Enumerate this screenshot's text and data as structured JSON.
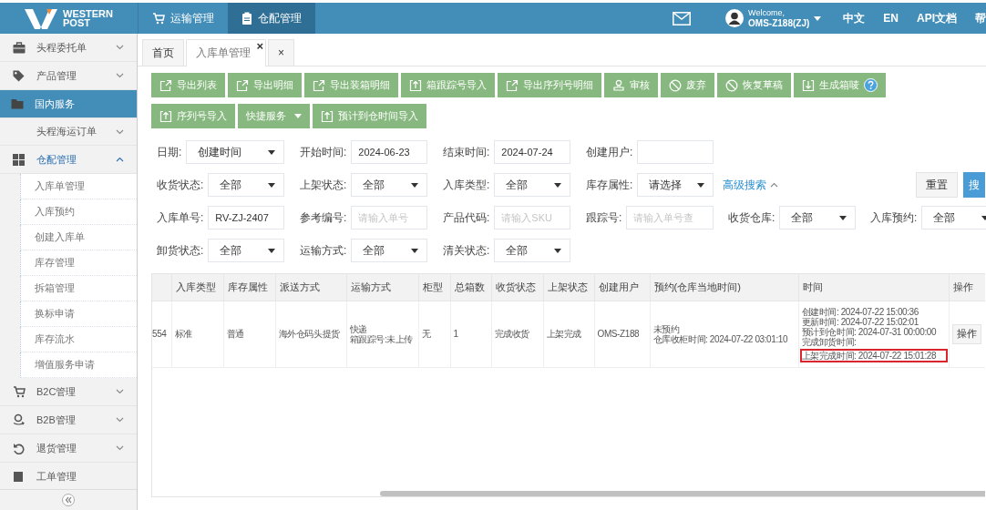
{
  "header": {
    "logo": [
      "WESTERN",
      "POST"
    ],
    "nav": [
      {
        "label": "运输管理",
        "selected": false
      },
      {
        "label": "仓配管理",
        "selected": true
      }
    ],
    "welcome": "Welcome,",
    "user": "OMS-Z188(ZJ)",
    "links": [
      "中文",
      "EN",
      "API文档",
      "帮"
    ]
  },
  "sidebar": {
    "items": [
      {
        "label": "头程委托单",
        "expanded": false,
        "selected": false
      },
      {
        "label": "产品管理",
        "expanded": false,
        "selected": false
      },
      {
        "label": "国内服务",
        "selected": true,
        "children": [
          {
            "label": "头程海运订单",
            "expanded": false,
            "selected": false
          }
        ]
      },
      {
        "label": "仓配管理",
        "expanded": true,
        "selected": false,
        "children": [
          {
            "label": "入库单管理",
            "selected": false
          },
          {
            "label": "入库预约",
            "selected": false
          },
          {
            "label": "创建入库单",
            "selected": false
          },
          {
            "label": "库存管理",
            "selected": false
          },
          {
            "label": "拆箱管理",
            "selected": false
          },
          {
            "label": "换标申请",
            "selected": false
          },
          {
            "label": "库存流水",
            "selected": false
          },
          {
            "label": "增值服务申请",
            "selected": false
          }
        ]
      },
      {
        "label": "B2C管理",
        "expanded": false,
        "selected": false
      },
      {
        "label": "B2B管理",
        "expanded": false,
        "selected": false
      },
      {
        "label": "退货管理",
        "expanded": false,
        "selected": false
      },
      {
        "label": "工单管理",
        "selected": false
      }
    ]
  },
  "tabs": [
    {
      "label": "首页",
      "selected": false
    },
    {
      "label": "入库单管理",
      "selected": true,
      "close": "×"
    },
    {
      "label": "×",
      "selected": false
    }
  ],
  "toolbar": [
    [
      {
        "label": "导出列表"
      },
      {
        "label": "导出明细"
      },
      {
        "label": "导出装箱明细"
      },
      {
        "label": "箱跟踪号导入"
      },
      {
        "label": "导出序列号明细"
      },
      {
        "label": "审核"
      },
      {
        "label": "废弃"
      },
      {
        "label": "恢复草稿"
      },
      {
        "label": "生成箱唛",
        "help": true
      }
    ],
    [
      {
        "label": "序列号导入"
      },
      {
        "label": "快捷服务",
        "dropdown": true
      },
      {
        "label": "预计到仓时间导入"
      }
    ]
  ],
  "filters": [
    {
      "fields": [
        {
          "label": "日期:",
          "kind": "select",
          "value": "创建时间"
        },
        {
          "label": "开始时间:",
          "kind": "input",
          "value": "2024-06-23"
        },
        {
          "label": "结束时间:",
          "kind": "input",
          "value": "2024-07-24"
        },
        {
          "label": "创建用户:",
          "kind": "input"
        }
      ]
    },
    {
      "fields": [
        {
          "label": "收货状态:",
          "kind": "select",
          "value": "全部"
        },
        {
          "label": "上架状态:",
          "kind": "select",
          "value": "全部"
        },
        {
          "label": "入库类型:",
          "kind": "select",
          "value": "全部"
        },
        {
          "label": "库存属性:",
          "kind": "select",
          "value": "请选择"
        }
      ],
      "link": "高级搜索",
      "buttons": [
        "重置",
        "搜"
      ]
    },
    {
      "fields": [
        {
          "label": "入库单号:",
          "kind": "input",
          "value": "RV-ZJ-2407"
        },
        {
          "label": "参考编号:",
          "kind": "input",
          "placeholder": "请输入单号"
        },
        {
          "label": "产品代码:",
          "kind": "input",
          "placeholder": "请输入SKU"
        },
        {
          "label": "跟踪号:",
          "kind": "input",
          "placeholder": "请输入单号查"
        },
        {
          "label": "收货仓库:",
          "kind": "select",
          "value": "全部"
        },
        {
          "label": "入库预约:",
          "kind": "select",
          "value": "全部"
        }
      ]
    },
    {
      "fields": [
        {
          "label": "卸货状态:",
          "kind": "select",
          "value": "全部"
        },
        {
          "label": "运输方式:",
          "kind": "select",
          "value": "全部"
        },
        {
          "label": "清关状态:",
          "kind": "select",
          "value": "全部"
        }
      ]
    }
  ],
  "table": {
    "columns": [
      "",
      "入库类型",
      "库存属性",
      "派送方式",
      "运输方式",
      "柜型",
      "总箱数",
      "收货状态",
      "上架状态",
      "创建用户",
      "预约(仓库当地时间)",
      "时间",
      "操作"
    ],
    "rows": [
      {
        "cells": [
          {
            "kind": "text",
            "text": "554"
          },
          {
            "kind": "text",
            "text": "标准"
          },
          {
            "kind": "text",
            "text": "普通"
          },
          {
            "kind": "text",
            "text": "海外仓码头提货"
          },
          {
            "kind": "lines",
            "lines": [
              "快递",
              "箱跟踪号:未上传"
            ]
          },
          {
            "kind": "text",
            "text": "无"
          },
          {
            "kind": "text",
            "text": "1"
          },
          {
            "kind": "text",
            "text": "完成收货"
          },
          {
            "kind": "text",
            "text": "上架完成"
          },
          {
            "kind": "text",
            "text": "OMS-Z188"
          },
          {
            "kind": "lines",
            "lines": [
              "未预约",
              "仓库收柜时间: 2024-07-22 03:01:10"
            ]
          },
          {
            "kind": "times",
            "lines": [
              {
                "text": "创建时间: 2024-07-22 15:00:36",
                "highlighted": false
              },
              {
                "text": "更新时间: 2024-07-22 15:02:01",
                "highlighted": false
              },
              {
                "text": "预计到仓时间: 2024-07-31 00:00:00",
                "highlighted": false
              },
              {
                "text": "完成卸货时间:",
                "highlighted": false
              },
              {
                "text": "上架完成时间: 2024-07-22 15:01:28",
                "highlighted": true
              }
            ]
          },
          {
            "kind": "button",
            "label": "操作"
          }
        ]
      }
    ]
  }
}
